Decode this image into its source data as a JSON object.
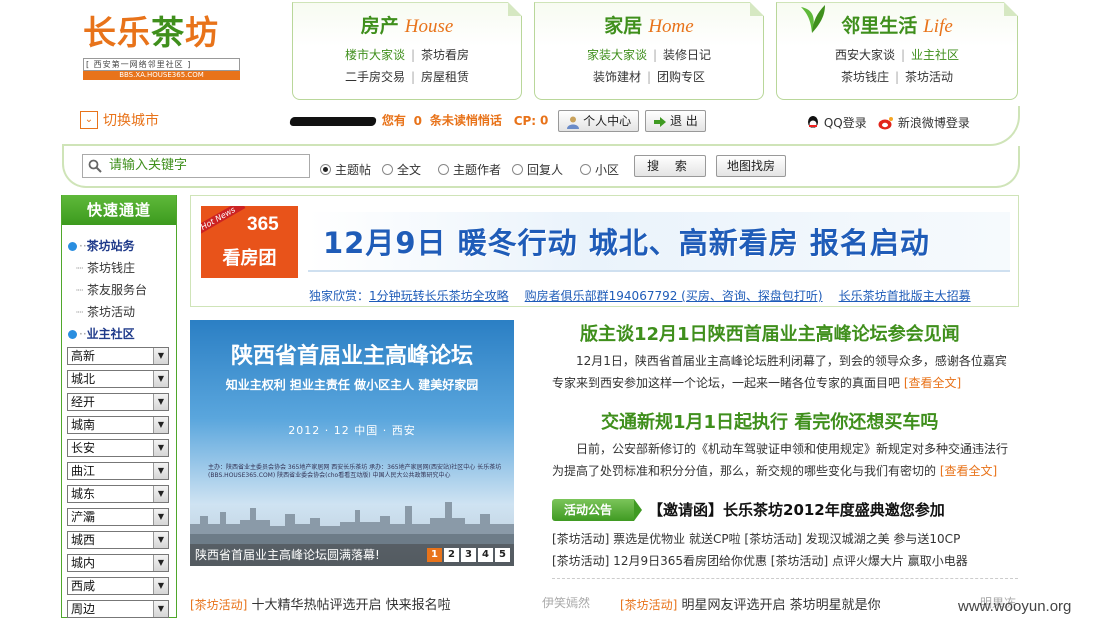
{
  "logo": {
    "main_a": "长乐",
    "main_b": "茶",
    "main_c": "坊",
    "slogan": "[ 西安第一网络邻里社区 ]",
    "domain": "BBS.XA.HOUSE365.COM"
  },
  "panels": [
    {
      "title": "房产",
      "title_en": "House",
      "row1": [
        "楼市大家谈",
        "茶坊看房"
      ],
      "row2": [
        "二手房交易",
        "房屋租赁"
      ]
    },
    {
      "title": "家居",
      "title_en": "Home",
      "row1": [
        "家装大家谈",
        "装修日记"
      ],
      "row2": [
        "装饰建材",
        "团购专区"
      ]
    },
    {
      "title": "邻里生活",
      "title_en": "Life",
      "row1": [
        "西安大家谈",
        "业主社区"
      ],
      "row2": [
        "茶坊钱庄",
        "茶坊活动"
      ]
    }
  ],
  "city_switch": {
    "icon": "chevron-down",
    "label": "切换城市"
  },
  "status": {
    "text_a": "您有",
    "unread_count": "0",
    "text_b": "条未读悄悄话",
    "cp_label": "CP:",
    "cp_value": "0",
    "user_center": "个人中心",
    "logout": "退 出",
    "qq_login": "QQ登录",
    "weibo_login": "新浪微博登录"
  },
  "search": {
    "placeholder": "请输入关键字",
    "options": [
      "主题帖",
      "全文",
      "主题作者",
      "回复人",
      "小区"
    ],
    "selected": "主题帖",
    "search_button": "搜 索",
    "map_button": "地图找房"
  },
  "sidebar": {
    "title": "快速通道",
    "group1": "茶坊站务",
    "group1_links": [
      "茶坊钱庄",
      "茶友服务台",
      "茶坊活动"
    ],
    "group2": "业主社区",
    "selects": [
      "高新",
      "城北",
      "经开",
      "城南",
      "长安",
      "曲江",
      "城东",
      "浐灞",
      "城西",
      "城内",
      "西咸",
      "周边"
    ]
  },
  "banner": {
    "hot_tag": "Hot News",
    "num": "365",
    "badge": "看房团",
    "headline": "12月9日  暖冬行动  城北、高新看房   报名启动",
    "links_prefix": "独家欣赏：",
    "links": [
      "1分钟玩转长乐茶坊全攻略",
      "购房者俱乐部群194067792 (买房、咨询、探盘包打听)",
      "长乐茶坊首批版主大招募"
    ]
  },
  "feature": {
    "title": "陕西省首届业主高峰论坛",
    "slogan": "知业主权利   担业主责任   做小区主人   建美好家园",
    "date": "2012 · 12     中国 · 西安",
    "info": "主办：陕西省业主委员会协会  365地产家居网  西安长乐茶坊  承办：365地产家居网(西安站)社区中心  长乐茶坊(BBS.HOUSE365.COM)  陕西省业委会协会(cho看看互动版)  中国人民大公共政策研究中心",
    "caption": "陕西省首届业主高峰论坛圆满落幕!",
    "pages": [
      "1",
      "2",
      "3",
      "4",
      "5"
    ],
    "active_page": "1"
  },
  "news": [
    {
      "title": "版主谈12月1日陕西首届业主高峰论坛参会见闻",
      "body": "12月1日，陕西省首届业主高峰论坛胜利闭幕了，到会的领导众多，感谢各位嘉宾专家来到西安参加这样一个论坛，一起来一睹各位专家的真面目吧",
      "more": "[查看全文]"
    },
    {
      "title": "交通新规1月1日起执行  看完你还想买车吗",
      "body": "日前，公安部新修订的《机动车驾驶证申领和使用规定》新规定对多种交通违法行为提高了处罚标准和积分分值，那么，新交规的哪些变化与我们有密切的",
      "more": "[查看全文]"
    }
  ],
  "activity": {
    "badge": "活动公告",
    "invite": "【邀请函】长乐茶坊2012年度盛典邀您参加",
    "row1": "[茶坊活动] 票选是优物业 就送CP啦  [茶坊活动] 发现汉城湖之美 参与送10CP",
    "row2": "[茶坊活动] 12月9日365看房团给你优惠   [茶坊活动] 点评火爆大片 赢取小电器"
  },
  "bottom": {
    "left_tag": "[茶坊活动]",
    "left_text": "十大精华热帖评选开启 快来报名啦",
    "mid_gray": "伊笑嫣然",
    "right_tag": "[茶坊活动]",
    "right_text": "明星网友评选开启 茶坊明星就是你",
    "right_gray": "明果冻"
  },
  "watermark": "www.wooyun.org",
  "colors": {
    "green": "#3f8f1c",
    "orange": "#e8731a",
    "blue": "#1f5cb8"
  }
}
